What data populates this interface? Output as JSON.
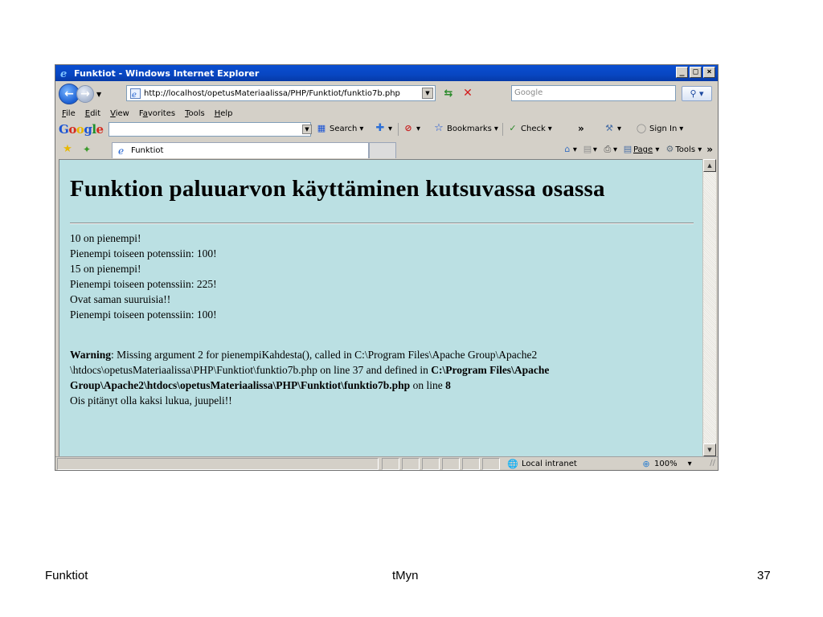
{
  "window": {
    "title": "Funktiot - Windows Internet Explorer",
    "minimize_glyph": "_",
    "maximize_glyph": "□",
    "close_glyph": "×"
  },
  "addressbar": {
    "url": "http://localhost/opetusMateriaalissa/PHP/Funktiot/funktio7b.php",
    "search_placeholder": "Google"
  },
  "menu": [
    {
      "u": "F",
      "rest": "ile"
    },
    {
      "u": "E",
      "rest": "dit"
    },
    {
      "u": "V",
      "rest": "iew"
    },
    {
      "pre": "F",
      "u": "a",
      "rest": "vorites"
    },
    {
      "u": "T",
      "rest": "ools"
    },
    {
      "u": "H",
      "rest": "elp"
    }
  ],
  "google_toolbar": {
    "logo": [
      "G",
      "o",
      "o",
      "g",
      "l",
      "e"
    ],
    "search_label": "Search",
    "bookmarks_label": "Bookmarks",
    "check_label": "Check",
    "more_glyph": "»",
    "signin_label": "Sign In"
  },
  "tabs": {
    "active_tab": "Funktiot",
    "page_label": "Page",
    "tools_label": "Tools",
    "more_glyph": "»"
  },
  "page": {
    "heading": "Funktion paluuarvon käyttäminen kutsuvassa osassa",
    "lines": [
      "10 on pienempi!",
      "Pienempi toiseen potenssiin: 100!",
      "15 on pienempi!",
      "Pienempi toiseen potenssiin: 225!",
      "Ovat saman suuruisia!!",
      "Pienempi toiseen potenssiin: 100!"
    ],
    "warning": {
      "label": "Warning",
      "text1": ": Missing argument 2 for pienempiKahdesta(), called in C:\\Program Files\\Apache Group\\Apache2 \\htdocs\\opetusMateriaalissa\\PHP\\Funktiot\\funktio7b.php on line 37 and defined in ",
      "path": "C:\\Program Files\\Apache Group\\Apache2\\htdocs\\opetusMateriaalissa\\PHP\\Funktiot\\funktio7b.php",
      "text2": " on line ",
      "line": "8"
    },
    "last_line": "Ois pitänyt olla kaksi lukua, juupeli!!"
  },
  "status": {
    "zone": "Local intranet",
    "zoom": "100%"
  },
  "footer": {
    "left": "Funktiot",
    "center": "tMyn",
    "right": "37"
  }
}
